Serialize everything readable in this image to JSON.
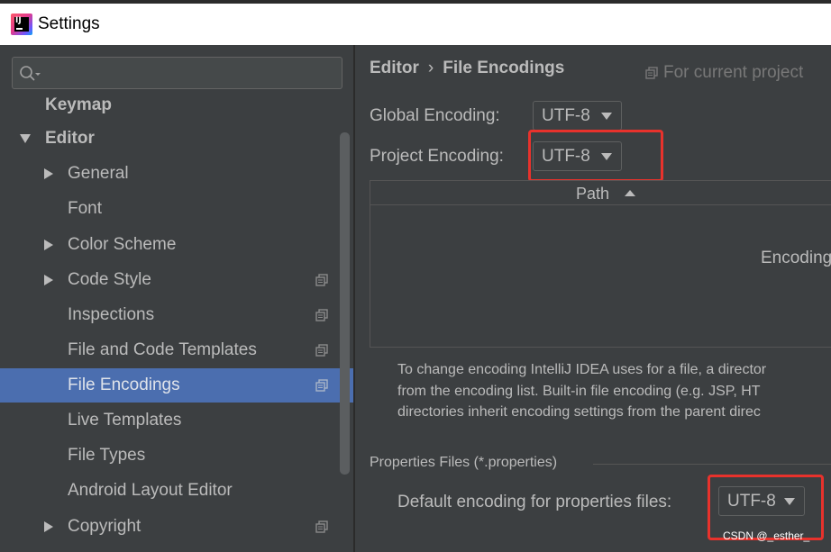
{
  "window": {
    "title": "Settings"
  },
  "search": {
    "placeholder": ""
  },
  "sidebar": {
    "items": [
      {
        "label": "Keymap"
      },
      {
        "label": "Editor"
      },
      {
        "label": "General"
      },
      {
        "label": "Font"
      },
      {
        "label": "Color Scheme"
      },
      {
        "label": "Code Style"
      },
      {
        "label": "Inspections"
      },
      {
        "label": "File and Code Templates"
      },
      {
        "label": "File Encodings"
      },
      {
        "label": "Live Templates"
      },
      {
        "label": "File Types"
      },
      {
        "label": "Android Layout Editor"
      },
      {
        "label": "Copyright"
      }
    ],
    "selected": "File Encodings"
  },
  "breadcrumb": {
    "parent": "Editor",
    "separator": "›",
    "current": "File Encodings"
  },
  "scope_hint": "For current project",
  "global_encoding": {
    "label": "Global Encoding:",
    "value": "UTF-8"
  },
  "project_encoding": {
    "label": "Project Encoding:",
    "value": "UTF-8"
  },
  "table": {
    "columns": [
      "Path",
      "Encoding"
    ],
    "rows": []
  },
  "description": {
    "line1": "To change encoding IntelliJ IDEA uses for a file, a director",
    "line2": "from the encoding list. Built-in file encoding (e.g. JSP, HT",
    "line3": "directories inherit encoding settings from the parent direc"
  },
  "properties_group": {
    "title": "Properties Files (*.properties)",
    "default_label": "Default encoding for properties files:",
    "value": "UTF-8"
  },
  "watermark": "CSDN @_esther_",
  "colors": {
    "background": "#3c3f41",
    "selection": "#4b6eaf",
    "text": "#bbbbbb",
    "highlight_box": "#e8322c"
  },
  "icons": [
    "intellij-idea-icon",
    "search-icon",
    "expand-arrow-icon",
    "project-scope-icon"
  ]
}
